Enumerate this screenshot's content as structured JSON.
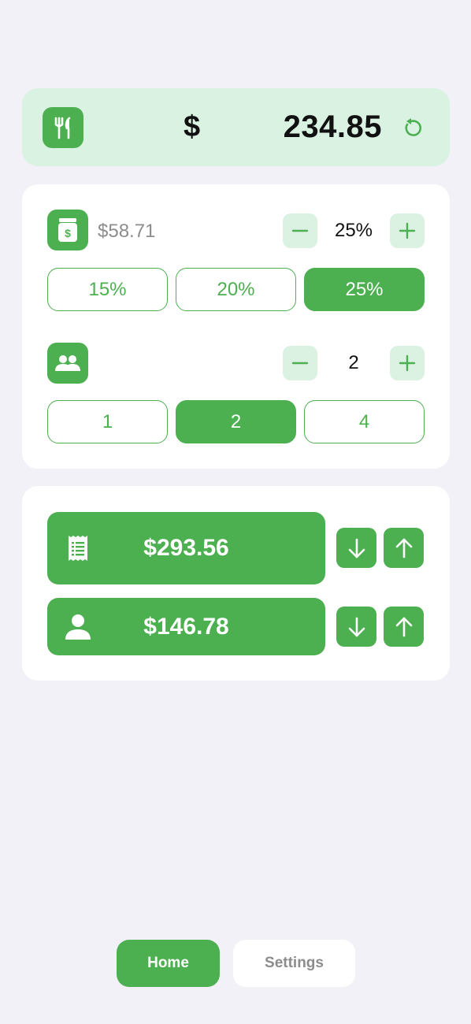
{
  "bill": {
    "currency_symbol": "$",
    "amount": "234.85",
    "icon": "fork-knife-icon",
    "reset_icon": "reset-icon"
  },
  "tip": {
    "icon": "tip-jar-icon",
    "amount": "$58.71",
    "percent": "25%",
    "presets": [
      "15%",
      "20%",
      "25%"
    ],
    "selected_preset": "25%"
  },
  "people": {
    "icon": "people-icon",
    "count": "2",
    "presets": [
      "1",
      "2",
      "4"
    ],
    "selected_preset": "2"
  },
  "results": {
    "total": {
      "icon": "receipt-icon",
      "value": "$293.56"
    },
    "per_person": {
      "icon": "person-icon",
      "value": "$146.78"
    }
  },
  "nav": {
    "home": "Home",
    "settings": "Settings"
  },
  "colors": {
    "accent": "#4caf50",
    "accent_light": "#daf2e2",
    "background": "#f2f1f7"
  }
}
